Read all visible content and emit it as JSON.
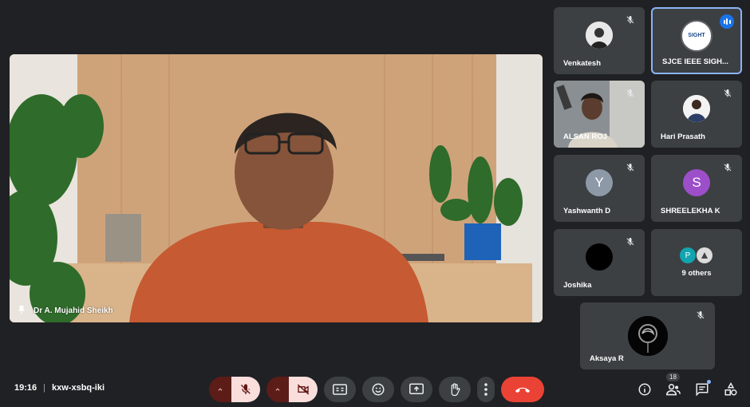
{
  "main_video": {
    "speaker_name": "Dr A. Mujahid Sheikh"
  },
  "participants": [
    {
      "name": "Venkatesh",
      "muted": true
    },
    {
      "name": "SJCE IEEE SIGH...",
      "speaking": true,
      "avatar_text": "SIGHT"
    },
    {
      "name": "ALSAN ROJ",
      "muted": true
    },
    {
      "name": "Hari Prasath",
      "muted": true
    },
    {
      "name": "Yashwanth D",
      "initial": "Y",
      "muted": true
    },
    {
      "name": "SHREELEKHA K",
      "initial": "S",
      "muted": true
    },
    {
      "name": "Joshika",
      "muted": true
    },
    {
      "name": "9 others",
      "initial": "P"
    },
    {
      "name": "Aksaya R",
      "muted": true
    }
  ],
  "footer": {
    "time": "19:16",
    "separator": "|",
    "meeting_code": "kxw-xsbq-iki"
  },
  "toolbar": {
    "people_count": "18"
  },
  "colors": {
    "background": "#202124",
    "tile": "#3c4043",
    "accent": "#8ab4f8",
    "end_call": "#ea4335",
    "muted_bg": "#f9dedc"
  }
}
